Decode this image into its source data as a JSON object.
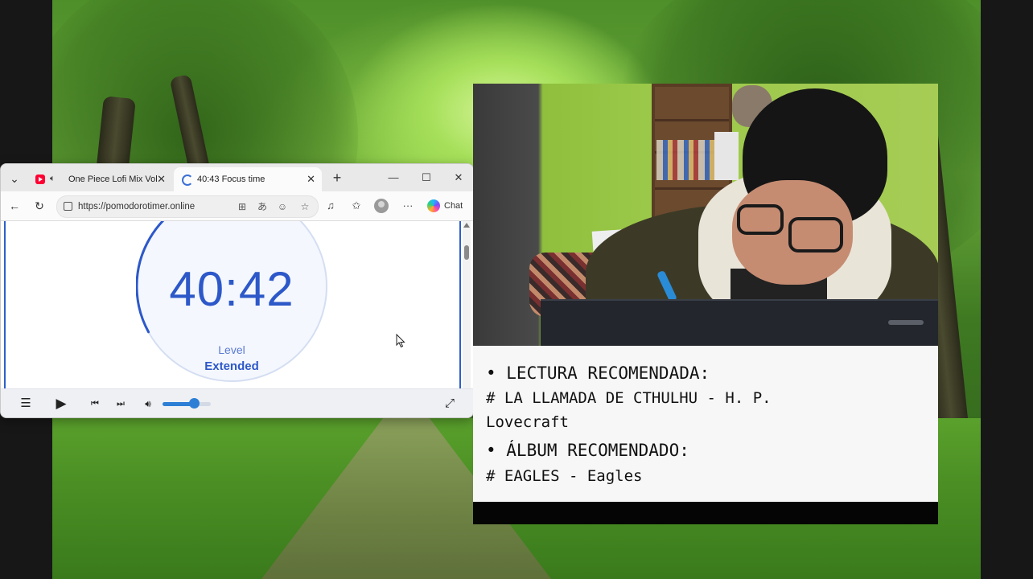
{
  "browser": {
    "tabs": [
      {
        "title": "One Piece Lofi Mix Vol.I",
        "icon": "youtube-icon",
        "audio_icon": "speaker-icon",
        "active": false
      },
      {
        "title": "40:43 Focus time",
        "icon": "loading-spinner-icon",
        "active": true
      }
    ],
    "address_bar": {
      "url": "https://pomodorotimer.online"
    },
    "toolbar": {
      "chat_label": "Chat"
    }
  },
  "timer": {
    "time": "40:42",
    "level_label": "Level",
    "level_value": "Extended",
    "progress_fraction": 0.33,
    "accent_color": "#2d58c9"
  },
  "player": {
    "volume_fraction": 0.65,
    "accent_color": "#2d7fd6"
  },
  "notes": {
    "reading_heading": "• LECTURA RECOMENDADA:",
    "reading_line1": "# LA LLAMADA DE CTHULHU - H. P.",
    "reading_line2": "Lovecraft",
    "album_heading": "• ÁLBUM RECOMENDADO:",
    "album_line": "# EAGLES - Eagles"
  }
}
